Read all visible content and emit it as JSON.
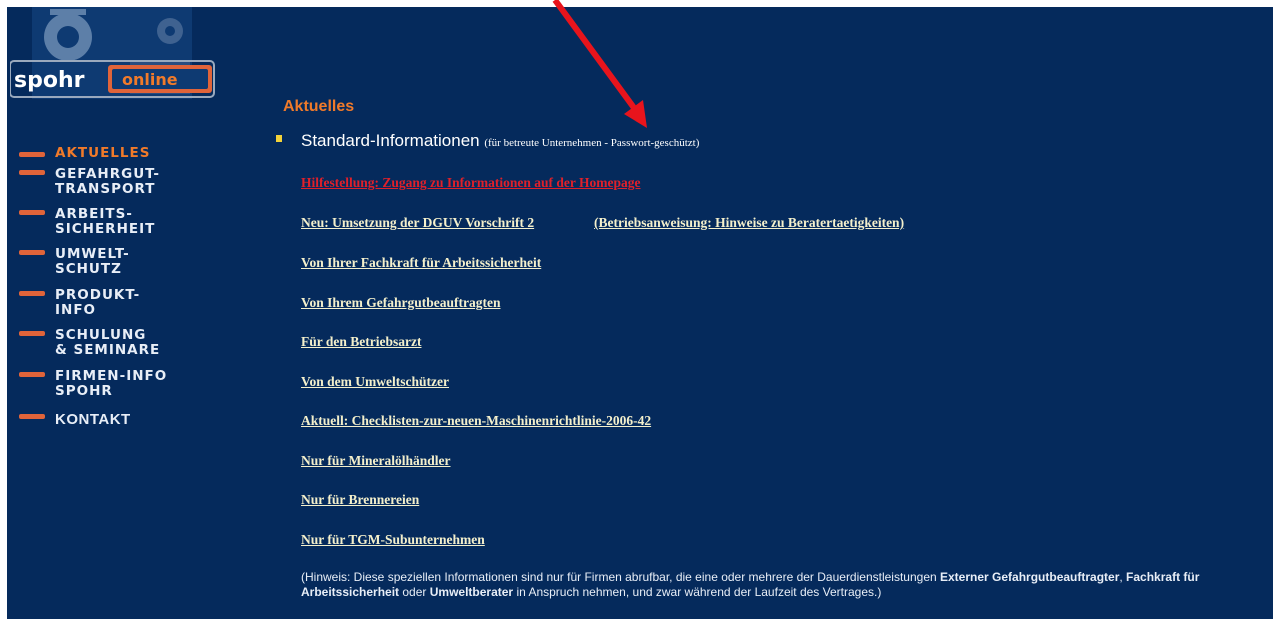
{
  "logo": {
    "brand": "spohr",
    "tag": "online"
  },
  "nav": [
    {
      "label": "AKTUELLES",
      "active": true
    },
    {
      "label": "GEFAHRGUT-\nTRANSPORT",
      "active": false
    },
    {
      "label": "ARBEITS-\nSICHERHEIT",
      "active": false
    },
    {
      "label": "UMWELT-\nSCHUTZ",
      "active": false
    },
    {
      "label": "PRODUKT-\nINFO",
      "active": false
    },
    {
      "label": "SCHULUNG\n& SEMINARE",
      "active": false
    },
    {
      "label": "FIRMEN-INFO\nSPOHR",
      "active": false
    },
    {
      "label": "KONTAKT",
      "active": false
    }
  ],
  "main": {
    "heading": "Aktuelles",
    "standard_title": "Standard-Informationen",
    "standard_note": "(für betreute Unternehmen - Passwort-geschützt)",
    "links": {
      "hilfe": "Hilfestellung: Zugang zu Informationen auf der Homepage",
      "dguv": "Neu: Umsetzung der DGUV Vorschrift 2",
      "betriebsanweisung": "(Betriebsanweisung: Hinweise zu Beratertaetigkeiten)",
      "fachkraft": "Von Ihrer Fachkraft für Arbeitssicherheit",
      "gefahrgut": "Von Ihrem Gefahrgutbeauftragten",
      "betriebsarzt": "Für den Betriebsarzt",
      "umwelt": "Von dem Umweltschützer",
      "checklisten": "Aktuell: Checklisten-zur-neuen-Maschinenrichtlinie-2006-42",
      "mineraloel": "Nur für Mineralölhändler",
      "brennereien": "Nur für Brennereien",
      "tgm": "Nur für TGM-Subunternehmen"
    },
    "note": {
      "part1": "(Hinweis: Diese speziellen Informationen sind nur für Firmen abrufbar, die eine oder mehrere der Dauerdienstleistungen ",
      "bold1": "Externer Gefahrgutbeauftragter",
      "part2": ", ",
      "bold2": "Fachkraft für Arbeitssicherheit",
      "part3": " oder ",
      "bold3": "Umweltberater",
      "part4": " in Anspruch nehmen, und zwar während der Laufzeit des Vertrages.)"
    }
  },
  "colors": {
    "background": "#052a5c",
    "accent": "#f07a2a",
    "link": "#f4f0cc",
    "alert": "#e0202a",
    "arrow": "#e8141c"
  }
}
